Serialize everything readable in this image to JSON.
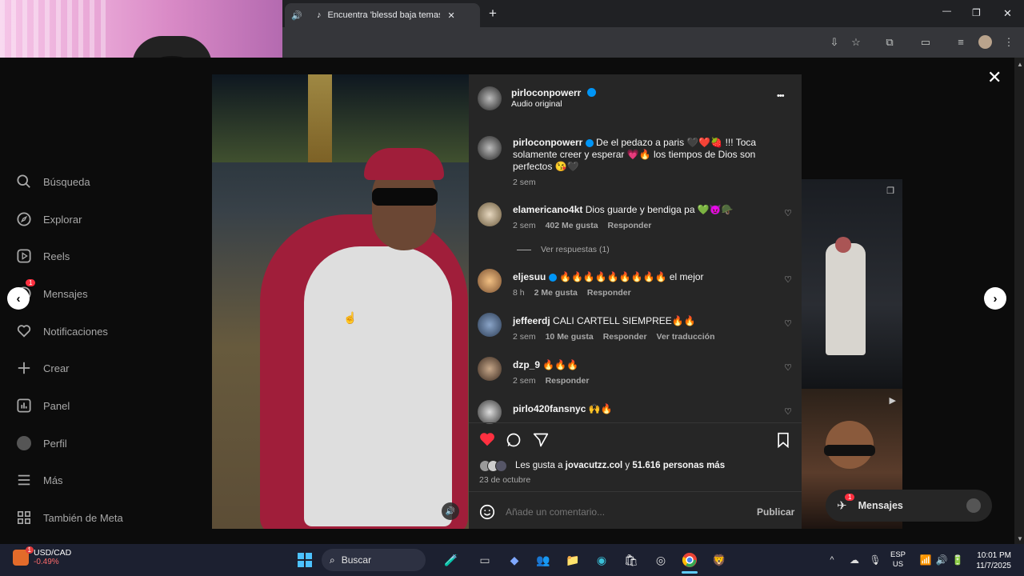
{
  "browser": {
    "tab_title": "Encuentra 'blessd baja temas de",
    "new_tab": "+",
    "close_tab": "✕",
    "window_min": "—",
    "window_max": "❐",
    "window_close": "✕"
  },
  "sidebar": {
    "items": [
      {
        "label": "Búsqueda",
        "icon": "search-icon"
      },
      {
        "label": "Explorar",
        "icon": "compass-icon"
      },
      {
        "label": "Reels",
        "icon": "reels-icon"
      },
      {
        "label": "Mensajes",
        "icon": "messenger-icon",
        "badge": "1"
      },
      {
        "label": "Notificaciones",
        "icon": "heart-icon"
      },
      {
        "label": "Crear",
        "icon": "plus-icon"
      },
      {
        "label": "Panel",
        "icon": "chart-icon"
      },
      {
        "label": "Perfil",
        "icon": "avatar-icon"
      },
      {
        "label": "Más",
        "icon": "menu-icon"
      },
      {
        "label": "También de Meta",
        "icon": "meta-icon"
      }
    ]
  },
  "post": {
    "author": "pirloconpowerr",
    "audio": "Audio original",
    "more": "•••",
    "caption_text": "De el pedazo a paris 🖤❤️🍓 !!! Toca solamente creer y esperar 💗🔥 los tiempos de Dios son perfectos 😘🖤",
    "caption_time": "2 sem",
    "comments": [
      {
        "user": "elamericano4kt",
        "text": "Dios guarde y bendiga pa 💚😈🪖",
        "time": "2 sem",
        "likes": "402 Me gusta",
        "reply": "Responder",
        "view_replies": "Ver respuestas (1)"
      },
      {
        "user": "eljesuu",
        "verified": true,
        "text": "🔥🔥🔥🔥🔥🔥🔥🔥🔥 el mejor",
        "time": "8 h",
        "likes": "2 Me gusta",
        "reply": "Responder"
      },
      {
        "user": "jeffeerdj",
        "text": "CALI CARTELL SIEMPREE🔥🔥",
        "time": "2 sem",
        "likes": "10 Me gusta",
        "reply": "Responder",
        "translate": "Ver traducción"
      },
      {
        "user": "dzp_9",
        "text": "🔥🔥🔥",
        "time": "2 sem",
        "reply": "Responder"
      },
      {
        "user": "pirlo420fansnyc",
        "text": "🙌🔥",
        "time": "",
        "reply": ""
      }
    ],
    "likes_prefix": "Les gusta a ",
    "likes_user": "jovacutzz.col",
    "likes_mid": " y ",
    "likes_count": "51.616 personas más",
    "date": "23 de octubre",
    "comment_placeholder": "Añade un comentario...",
    "publish": "Publicar"
  },
  "messages_pill": {
    "label": "Mensajes",
    "badge": "1"
  },
  "taskbar": {
    "ticker_name": "USD/CAD",
    "ticker_change": "-0.49%",
    "ticker_badge": "1",
    "search": "Buscar",
    "lang1": "ESP",
    "lang2": "US",
    "time": "10:01 PM",
    "date": "11/7/2025"
  },
  "colors": {
    "accent_red": "#ff3040",
    "panel_bg": "#262626",
    "taskbar_bg": "#1c2030"
  }
}
